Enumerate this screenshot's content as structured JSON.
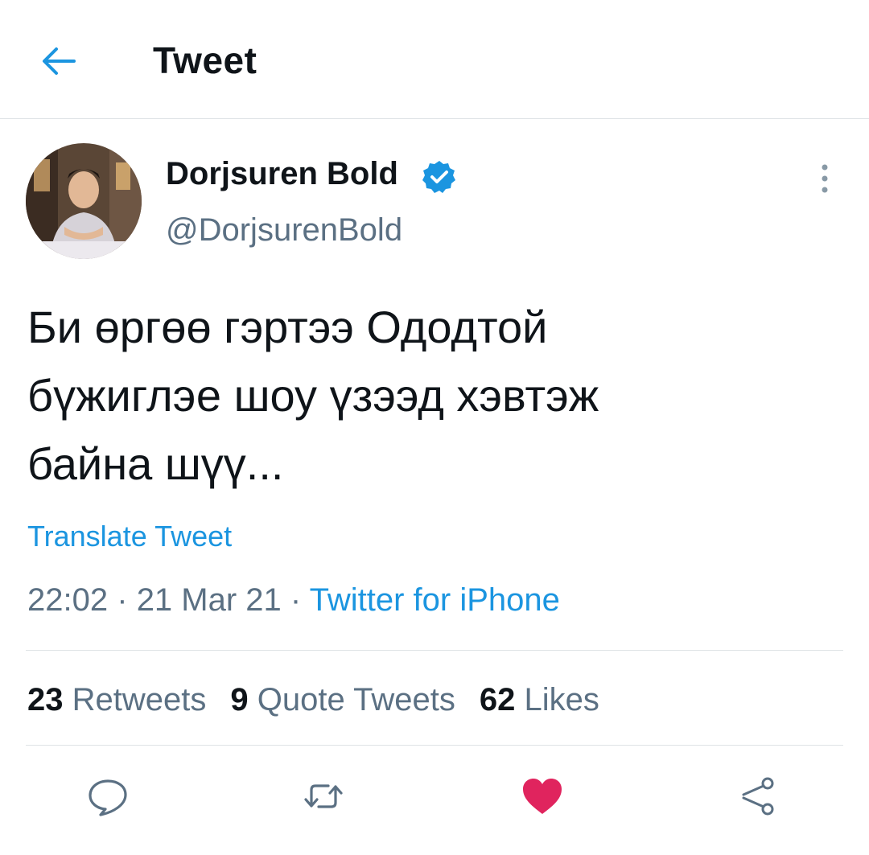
{
  "header": {
    "title": "Tweet"
  },
  "author": {
    "name": "Dorjsuren Bold",
    "handle": "@DorjsurenBold"
  },
  "tweet": {
    "lines": [
      "Би өргөө гэртээ Ододтой",
      "бүжиглэе шоу үзээд хэвтэж",
      "байна шүү..."
    ],
    "translate_label": "Translate Tweet",
    "time": "22:02",
    "date": "21 Mar 21",
    "separator": "·",
    "source": "Twitter for iPhone"
  },
  "stats": {
    "retweets_count": "23",
    "retweets_label": "Retweets",
    "quotes_count": "9",
    "quotes_label": "Quote Tweets",
    "likes_count": "62",
    "likes_label": "Likes"
  },
  "colors": {
    "accent": "#1b95e0",
    "like": "#e0245e",
    "muted": "#5b7083",
    "divider": "#dfe3e6"
  },
  "icons": [
    "back-arrow-icon",
    "verified-badge-icon",
    "more-vertical-icon",
    "reply-icon",
    "retweet-icon",
    "like-heart-icon",
    "share-icon"
  ]
}
